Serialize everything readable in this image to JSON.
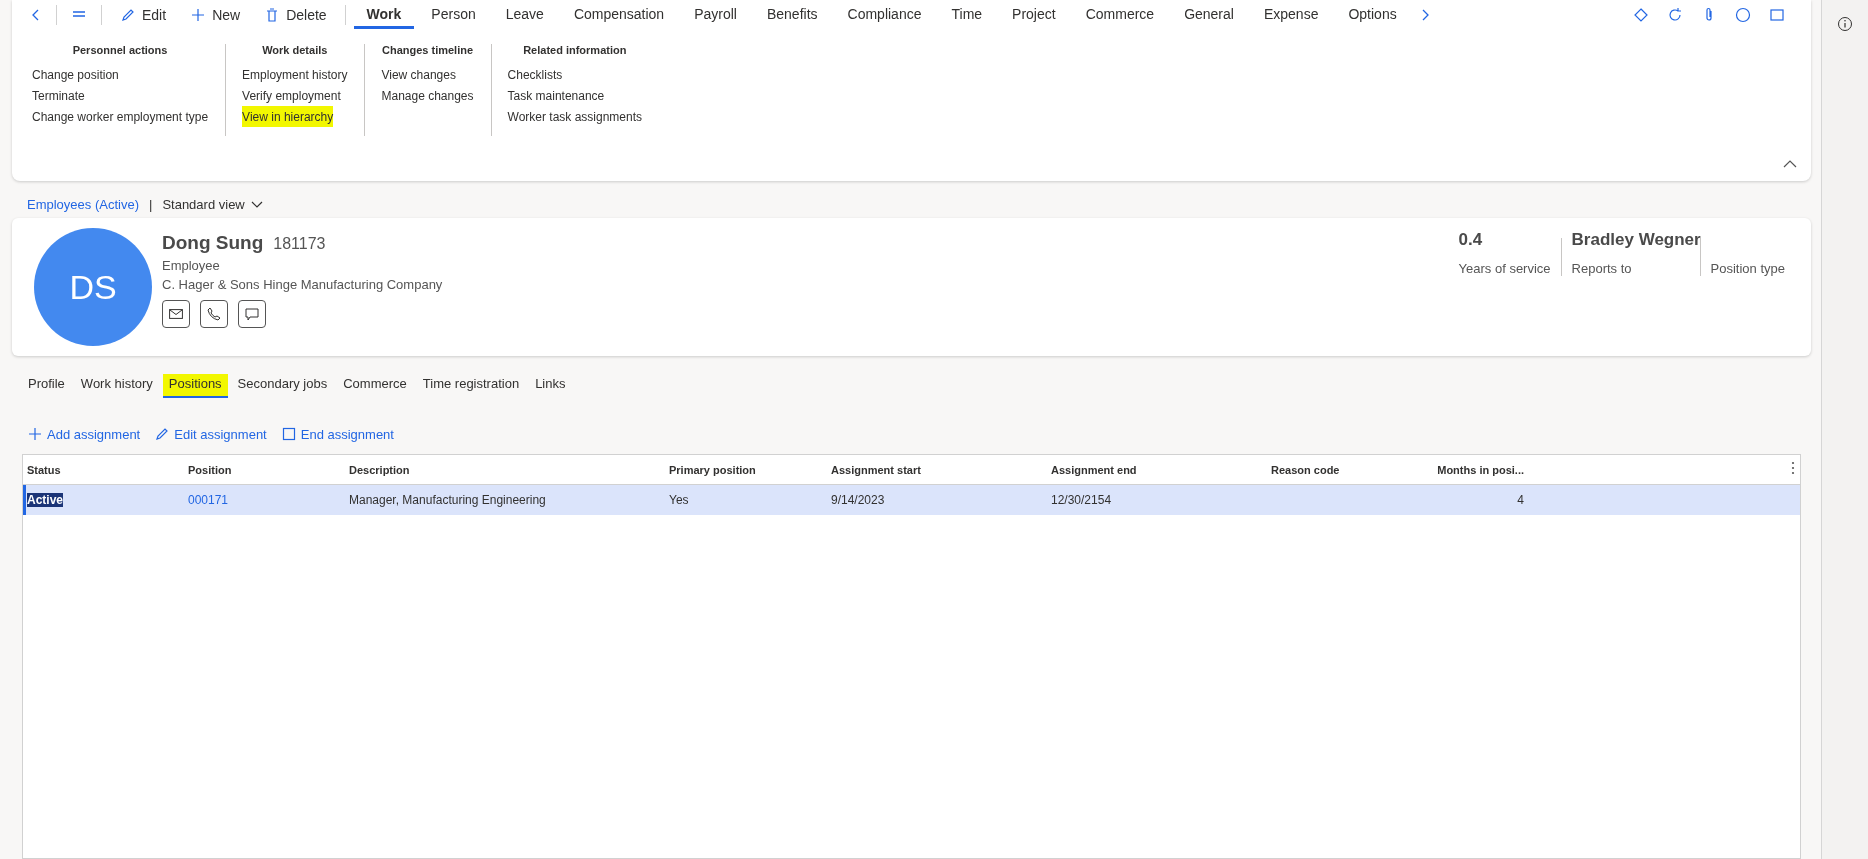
{
  "toolbar": {
    "commands": [
      {
        "label": "Edit",
        "kind": "pencil"
      },
      {
        "label": "New",
        "kind": "plus"
      },
      {
        "label": "Delete",
        "kind": "trash"
      }
    ],
    "menu_tabs": [
      {
        "label": "Work",
        "selected": true
      },
      {
        "label": "Person",
        "selected": false
      },
      {
        "label": "Leave",
        "selected": false
      },
      {
        "label": "Compensation",
        "selected": false
      },
      {
        "label": "Payroll",
        "selected": false
      },
      {
        "label": "Benefits",
        "selected": false
      },
      {
        "label": "Compliance",
        "selected": false
      },
      {
        "label": "Time",
        "selected": false
      },
      {
        "label": "Project",
        "selected": false
      },
      {
        "label": "Commerce",
        "selected": false
      },
      {
        "label": "General",
        "selected": false
      },
      {
        "label": "Expense",
        "selected": false
      },
      {
        "label": "Options",
        "selected": false
      }
    ]
  },
  "ribbon": {
    "groups": [
      {
        "title": "Personnel actions",
        "items": [
          {
            "label": "Change position",
            "highlighted": false
          },
          {
            "label": "Terminate",
            "highlighted": false
          },
          {
            "label": "Change worker employment type",
            "highlighted": false
          }
        ]
      },
      {
        "title": "Work details",
        "items": [
          {
            "label": "Employment history",
            "highlighted": false
          },
          {
            "label": "Verify employment",
            "highlighted": false
          },
          {
            "label": "View in hierarchy",
            "highlighted": true
          }
        ]
      },
      {
        "title": "Changes timeline",
        "items": [
          {
            "label": "View changes",
            "highlighted": false
          },
          {
            "label": "Manage changes",
            "highlighted": false
          }
        ]
      },
      {
        "title": "Related information",
        "items": [
          {
            "label": "Checklists",
            "highlighted": false
          },
          {
            "label": "Task maintenance",
            "highlighted": false
          },
          {
            "label": "Worker task assignments",
            "highlighted": false
          }
        ]
      }
    ]
  },
  "breadcrumb": {
    "list": "Employees (Active)",
    "separator": "|",
    "view": "Standard view"
  },
  "employee": {
    "initials": "DS",
    "name": "Dong Sung",
    "id": "181173",
    "type": "Employee",
    "company": "C. Hager & Sons Hinge Manufacturing Company",
    "stats": [
      {
        "value": "0.4",
        "label": "Years of service"
      },
      {
        "value": "Bradley Wegner",
        "label": "Reports to"
      },
      {
        "label": "Position type"
      }
    ]
  },
  "tabs": [
    {
      "label": "Profile",
      "selected": false,
      "highlighted": false
    },
    {
      "label": "Work history",
      "selected": false,
      "highlighted": false
    },
    {
      "label": "Positions",
      "selected": true,
      "highlighted": true
    },
    {
      "label": "Secondary jobs",
      "selected": false,
      "highlighted": false
    },
    {
      "label": "Commerce",
      "selected": false,
      "highlighted": false
    },
    {
      "label": "Time registration",
      "selected": false,
      "highlighted": false
    },
    {
      "label": "Links",
      "selected": false,
      "highlighted": false
    }
  ],
  "actions": [
    {
      "label": "Add assignment",
      "kind": "plus"
    },
    {
      "label": "Edit assignment",
      "kind": "pencil"
    },
    {
      "label": "End assignment",
      "kind": "square"
    }
  ],
  "grid": {
    "columns": [
      {
        "label": "Status",
        "kind": "text"
      },
      {
        "label": "Position",
        "kind": "link"
      },
      {
        "label": "Description",
        "kind": "text"
      },
      {
        "label": "Primary position",
        "kind": "text"
      },
      {
        "label": "Assignment start",
        "kind": "text"
      },
      {
        "label": "Assignment end",
        "kind": "text"
      },
      {
        "label": "Reason code",
        "kind": "text"
      },
      {
        "label": "Months in posi...",
        "kind": "number"
      }
    ],
    "rows": [
      {
        "selected": true,
        "first_cell_text_selected": true,
        "cells": [
          "Active",
          "000171",
          "Manager, Manufacturing Engineering",
          "Yes",
          "9/14/2023",
          "12/30/2154",
          "",
          "4"
        ]
      }
    ]
  }
}
